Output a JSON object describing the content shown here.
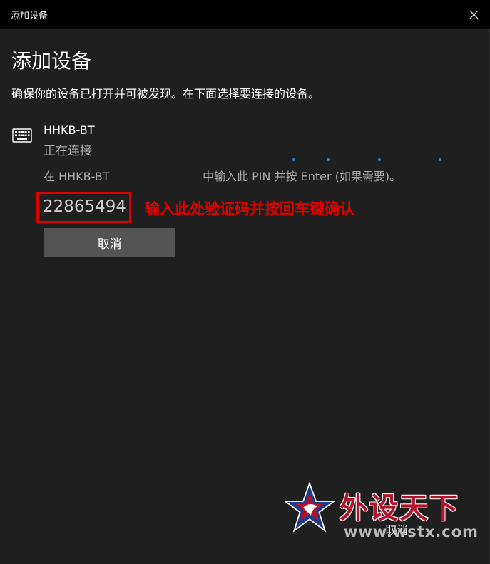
{
  "window": {
    "title": "添加设备",
    "close_icon": "close-icon"
  },
  "main": {
    "heading": "添加设备",
    "subtitle": "确保你的设备已打开并可被发现。在下面选择要连接的设备。"
  },
  "device": {
    "icon": "keyboard-icon",
    "name": "HHKB-BT",
    "status": "正在连接",
    "pin_prompt_part1": "在 HHKB-BT",
    "pin_prompt_part2": "中输入此 PIN 并按 Enter (如果需要)。",
    "pin": "22865494",
    "cancel_label": "取消"
  },
  "annotation": {
    "text": "输入此处验证码并按回车键确认",
    "color": "#e00000"
  },
  "footer": {
    "cancel_label": "取消"
  },
  "watermark": {
    "logo": "star-eagle-logo",
    "text": "外设天下",
    "url": "www.wstx.com"
  },
  "colors": {
    "accent": "#1a82e2",
    "background": "#1f1f1f",
    "titlebar": "#000000",
    "button": "#545454"
  }
}
